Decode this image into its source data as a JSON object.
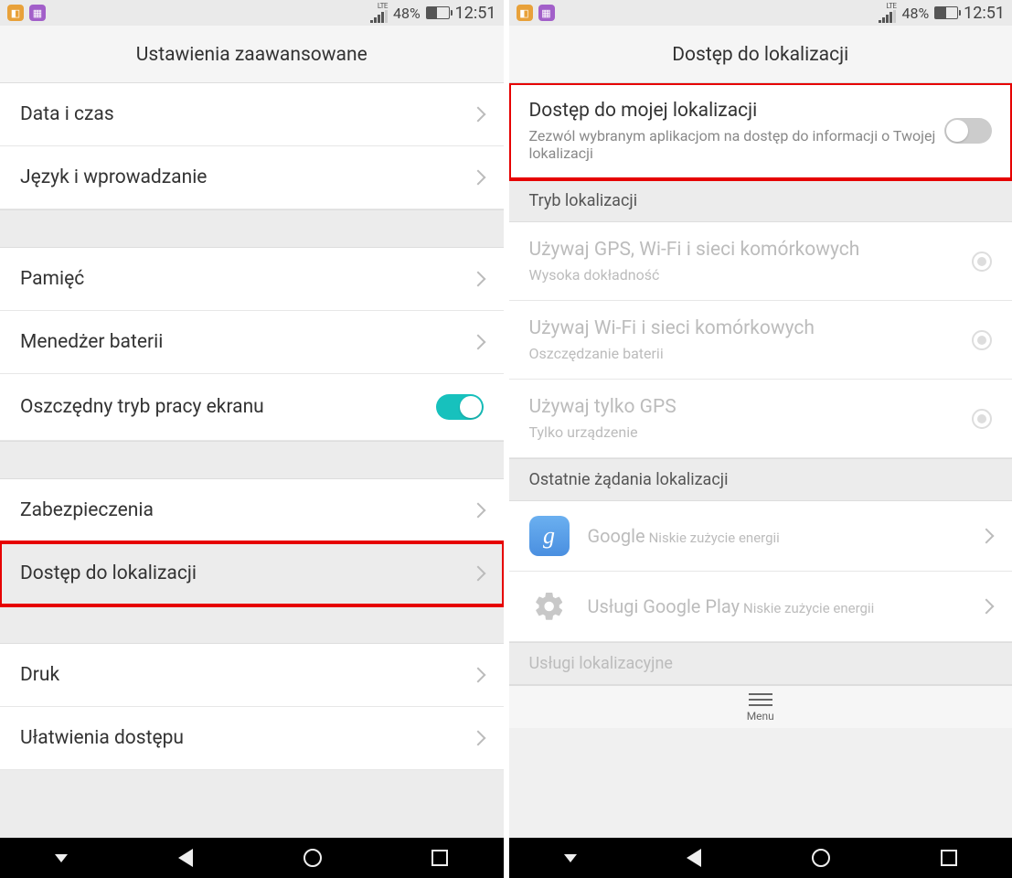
{
  "status": {
    "lte": "LTE",
    "battery_pct": "48%",
    "time": "12:51"
  },
  "left": {
    "title": "Ustawienia zaawansowane",
    "rows": {
      "date_time": "Data i czas",
      "lang_input": "Język i wprowadzanie",
      "memory": "Pamięć",
      "battery_mgr": "Menedżer baterii",
      "eco_screen": "Oszczędny tryb pracy ekranu",
      "security": "Zabezpieczenia",
      "location": "Dostęp do lokalizacji",
      "print": "Druk",
      "accessibility": "Ułatwienia dostępu"
    }
  },
  "right": {
    "title": "Dostęp do lokalizacji",
    "my_location": {
      "title": "Dostęp do mojej lokalizacji",
      "sub": "Zezwól wybranym aplikacjom na dostęp do informacji o Twojej lokalizacji"
    },
    "mode_header": "Tryb lokalizacji",
    "modes": {
      "gps_wifi_cell": {
        "title": "Używaj GPS, Wi-Fi i sieci komórkowych",
        "sub": "Wysoka dokładność"
      },
      "wifi_cell": {
        "title": "Używaj Wi-Fi i sieci komórkowych",
        "sub": "Oszczędzanie baterii"
      },
      "gps_only": {
        "title": "Używaj tylko GPS",
        "sub": "Tylko urządzenie"
      }
    },
    "recent_header": "Ostatnie żądania lokalizacji",
    "apps": {
      "google": {
        "name": "Google",
        "sub": "Niskie zużycie energii"
      },
      "play_services": {
        "name": "Usługi Google Play",
        "sub": "Niskie zużycie energii"
      }
    },
    "services_header": "Usługi lokalizacyjne",
    "menu": "Menu"
  }
}
